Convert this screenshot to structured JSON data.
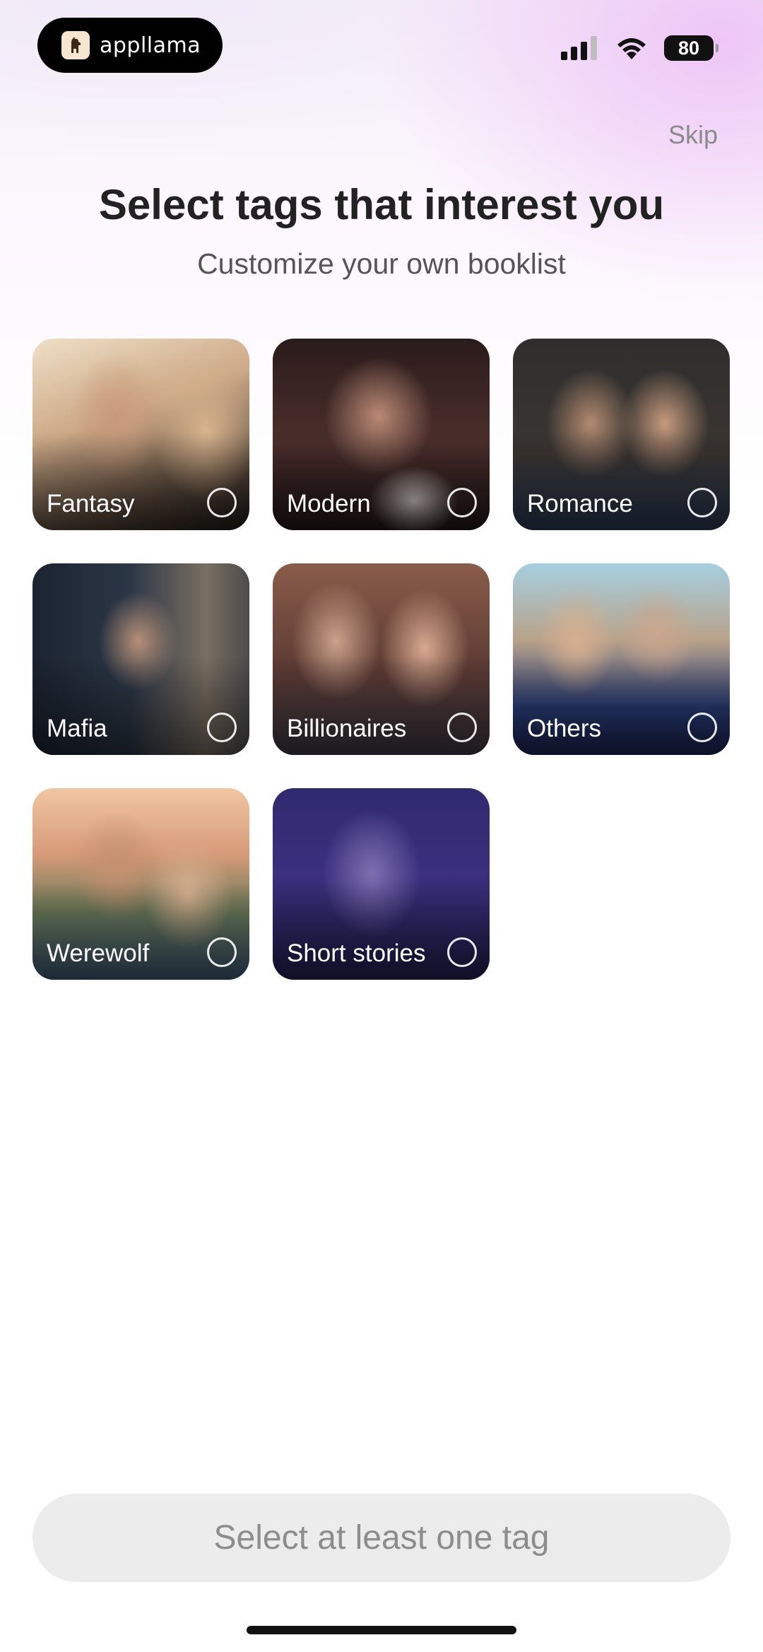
{
  "status_bar": {
    "brand": "appllama",
    "battery": "80"
  },
  "header": {
    "skip": "Skip",
    "title": "Select tags that interest you",
    "subtitle": "Customize your own booklist"
  },
  "tags": [
    {
      "label": "Fantasy",
      "selected": false
    },
    {
      "label": "Modern",
      "selected": false
    },
    {
      "label": "Romance",
      "selected": false
    },
    {
      "label": "Mafia",
      "selected": false
    },
    {
      "label": "Billionaires",
      "selected": false
    },
    {
      "label": "Others",
      "selected": false
    },
    {
      "label": "Werewolf",
      "selected": false
    },
    {
      "label": "Short stories",
      "selected": false
    }
  ],
  "footer": {
    "cta": "Select at least one tag"
  },
  "icons": [
    "llama-logo-icon",
    "cellular-signal-icon",
    "wifi-icon",
    "battery-icon"
  ]
}
